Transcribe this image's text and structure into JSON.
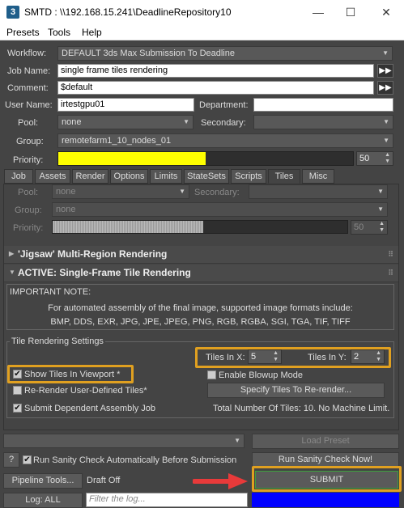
{
  "window": {
    "app_icon": "3",
    "title": "SMTD : \\\\192.168.15.241\\DeadlineRepository10",
    "minimize": "—",
    "maximize": "☐",
    "close": "✕"
  },
  "menu": [
    "Presets",
    "Tools",
    "Help"
  ],
  "form": {
    "workflow_label": "Workflow:",
    "workflow_value": "DEFAULT 3ds Max Submission To Deadline",
    "job_name_label": "Job Name:",
    "job_name_value": "single frame tiles rendering",
    "comment_label": "Comment:",
    "comment_value": "$default",
    "user_name_label": "User Name:",
    "user_name_value": "irtestgpu01",
    "department_label": "Department:",
    "department_value": "",
    "pool_label": "Pool:",
    "pool_value": "none",
    "secondary_label": "Secondary:",
    "secondary_value": "",
    "group_label": "Group:",
    "group_value": "remotefarm1_10_nodes_01",
    "priority_label": "Priority:",
    "priority_value": "50",
    "priority_fraction": 0.5,
    "priority_color": "#ffff00",
    "more_glyph": "▶▶"
  },
  "tabs": [
    "Job",
    "Assets",
    "Render",
    "Options",
    "Limits",
    "StateSets",
    "Scripts",
    "Tiles",
    "Misc"
  ],
  "active_tab": "Tiles",
  "tiles_panel": {
    "pool_label": "Pool:",
    "pool_value": "none",
    "secondary_label": "Secondary:",
    "group_label": "Group:",
    "group_value": "none",
    "priority_label": "Priority:",
    "priority_value": "50",
    "priority_fraction": 0.51,
    "jigsaw_title": "'Jigsaw' Multi-Region Rendering",
    "active_title": "ACTIVE: Single-Frame Tile Rendering",
    "important_heading": "IMPORTANT NOTE:",
    "important_line1": "For automated assembly of the final image, supported image formats include:",
    "important_line2": "BMP, DDS, EXR, JPG, JPE, JPEG, PNG, RGB, RGBA, SGI, TGA, TIF, TIFF",
    "settings_heading": "Tile Rendering Settings",
    "tiles_x_label": "Tiles In X:",
    "tiles_x_value": "5",
    "tiles_y_label": "Tiles In Y:",
    "tiles_y_value": "2",
    "show_tiles_label": "Show Tiles In Viewport *",
    "show_tiles_checked": true,
    "blowup_label": "Enable Blowup Mode",
    "blowup_checked": false,
    "rerender_label": "Re-Render User-Defined Tiles*",
    "rerender_checked": false,
    "specify_button": "Specify Tiles To Re-render...",
    "submit_dep_label": "Submit Dependent Assembly Job",
    "submit_dep_checked": true,
    "total_tiles": "Total Number Of Tiles: 10. No Machine Limit."
  },
  "bottom": {
    "help_button": "?",
    "load_preset": "Load Preset",
    "sanity_label": "Run Sanity Check Automatically Before Submission",
    "sanity_checked": true,
    "run_sanity": "Run Sanity Check Now!",
    "pipeline_tools": "Pipeline Tools...",
    "draft_status": "Draft Off",
    "submit": "SUBMIT",
    "log_button": "Log: ALL",
    "log_placeholder": "Filter the log...",
    "status_bar_color": "#0000ff"
  },
  "annotations": {
    "highlight_color": "#e0a020",
    "arrow_color": "#e83a3a"
  }
}
